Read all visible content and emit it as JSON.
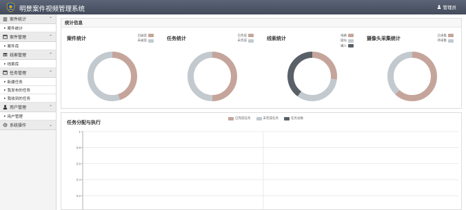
{
  "app": {
    "title": "明景案件视频管理系统",
    "user": "管理员"
  },
  "sidebar": {
    "groups": [
      {
        "label": "案件统计",
        "icon": "bar-chart-icon",
        "items": [
          "案件统计"
        ]
      },
      {
        "label": "案件管理",
        "icon": "list-icon",
        "items": [
          "案件库"
        ]
      },
      {
        "label": "线索管理",
        "icon": "table-icon",
        "items": [
          "线索库"
        ]
      },
      {
        "label": "任务管理",
        "icon": "list-icon",
        "items": [
          "新建任务",
          "我发布的任务",
          "我收到的任务"
        ]
      },
      {
        "label": "用户管理",
        "icon": "user-icon",
        "items": [
          "用户管理"
        ]
      },
      {
        "label": "系统操作",
        "icon": "gear-icon",
        "items": []
      }
    ]
  },
  "stats": {
    "title": "统计信息",
    "cards": [
      {
        "title": "案件统计",
        "legend": [
          {
            "label": "已破案",
            "color": "#c5a59b"
          },
          {
            "label": "未破案",
            "color": "#c2c9cf"
          }
        ]
      },
      {
        "title": "任务统计",
        "legend": [
          {
            "label": "已完成",
            "color": "#c5a59b"
          },
          {
            "label": "未完成",
            "color": "#c2c9cf"
          }
        ]
      },
      {
        "title": "线索统计",
        "legend": [
          {
            "label": "线路",
            "color": "#c5a59b"
          },
          {
            "label": "疑似",
            "color": "#c2c9cf"
          },
          {
            "label": "嫌人",
            "color": "#5a6068"
          }
        ]
      },
      {
        "title": "摄像头采集统计",
        "legend": [
          {
            "label": "已采集",
            "color": "#c5a59b"
          },
          {
            "label": "待采集",
            "color": "#c2c9cf"
          }
        ]
      }
    ]
  },
  "task_chart": {
    "title": "任务分配与执行",
    "legend": [
      {
        "label": "已完成任务",
        "color": "#c5a59b"
      },
      {
        "label": "未完成任务",
        "color": "#c2c9cf"
      },
      {
        "label": "任务总数",
        "color": "#5a6068"
      }
    ]
  },
  "chart_data": [
    {
      "type": "pie",
      "title": "案件统计",
      "labels": [
        "已破案",
        "未破案"
      ],
      "values": [
        45,
        55
      ]
    },
    {
      "type": "pie",
      "title": "任务统计",
      "labels": [
        "已完成",
        "未完成"
      ],
      "values": [
        50,
        50
      ]
    },
    {
      "type": "pie",
      "title": "线索统计",
      "labels": [
        "线路",
        "疑似",
        "嫌人"
      ],
      "values": [
        27,
        33,
        40
      ]
    },
    {
      "type": "pie",
      "title": "摄像头采集统计",
      "labels": [
        "已采集",
        "待采集"
      ],
      "values": [
        62,
        38
      ]
    },
    {
      "type": "bar",
      "title": "任务分配与执行",
      "series": [
        {
          "name": "已完成任务",
          "values": []
        },
        {
          "name": "未完成任务",
          "values": []
        },
        {
          "name": "任务总数",
          "values": []
        }
      ],
      "categories": [],
      "ylim": [
        0,
        1
      ],
      "yticks": [
        "1",
        "0.8",
        "0.6",
        "0.4",
        "0.2"
      ],
      "grid": true,
      "legend": "top"
    }
  ]
}
